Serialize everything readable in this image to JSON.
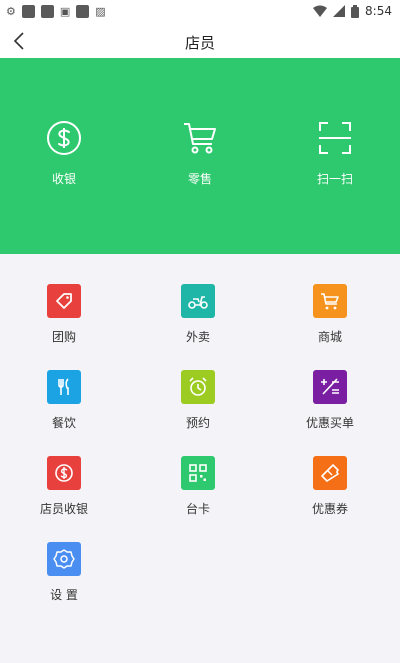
{
  "status_bar": {
    "time": "8:54",
    "left_icons": [
      "notification-icon",
      "app-icon",
      "app-icon",
      "sim-icon",
      "app-icon",
      "image-icon"
    ],
    "right_icons": [
      "wifi-icon",
      "signal-icon",
      "battery-icon"
    ]
  },
  "nav": {
    "title": "店员",
    "back_icon": "chevron-left-icon"
  },
  "hero": {
    "background": "#2ec96e",
    "items": [
      {
        "label": "收银",
        "icon": "dollar-circle-icon"
      },
      {
        "label": "零售",
        "icon": "cart-icon"
      },
      {
        "label": "扫一扫",
        "icon": "scan-icon"
      }
    ]
  },
  "grid": {
    "items": [
      {
        "label": "团购",
        "icon": "tag-icon",
        "color": "#e8413d"
      },
      {
        "label": "外卖",
        "icon": "scooter-icon",
        "color": "#1fb5a7"
      },
      {
        "label": "商城",
        "icon": "cart-icon",
        "color": "#f5931e"
      },
      {
        "label": "餐饮",
        "icon": "fork-knife-icon",
        "color": "#1ba3e3"
      },
      {
        "label": "预约",
        "icon": "alarm-clock-icon",
        "color": "#9ccb22"
      },
      {
        "label": "优惠买单",
        "icon": "calculator-icon",
        "color": "#7b1fa2"
      },
      {
        "label": "店员收银",
        "icon": "dollar-circle-icon",
        "color": "#e8413d"
      },
      {
        "label": "台卡",
        "icon": "qr-code-icon",
        "color": "#2ec96e"
      },
      {
        "label": "优惠券",
        "icon": "ticket-icon",
        "color": "#f56f17"
      },
      {
        "label": "设 置",
        "icon": "gear-icon",
        "color": "#4b8ef2"
      }
    ]
  }
}
